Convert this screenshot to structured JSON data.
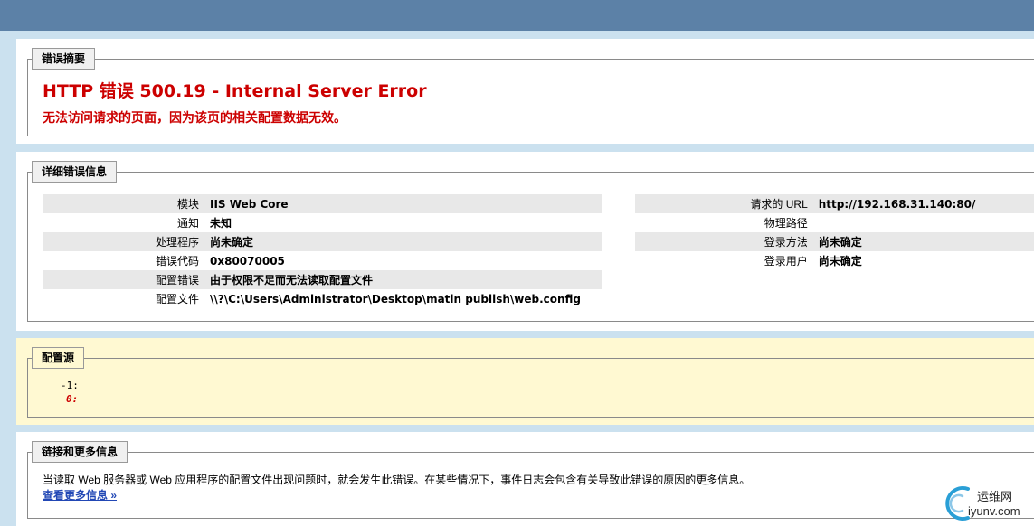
{
  "summary": {
    "legend": "错误摘要",
    "title": "HTTP 错误 500.19 - Internal Server Error",
    "subtitle": "无法访问请求的页面，因为该页的相关配置数据无效。"
  },
  "details": {
    "legend": "详细错误信息",
    "left": [
      {
        "label": "模块",
        "value": "IIS Web Core"
      },
      {
        "label": "通知",
        "value": "未知"
      },
      {
        "label": "处理程序",
        "value": "尚未确定"
      },
      {
        "label": "错误代码",
        "value": "0x80070005"
      },
      {
        "label": "配置错误",
        "value": "由于权限不足而无法读取配置文件"
      },
      {
        "label": "配置文件",
        "value": "\\\\?\\C:\\Users\\Administrator\\Desktop\\matin publish\\web.config"
      }
    ],
    "right": [
      {
        "label": "请求的 URL",
        "value": "http://192.168.31.140:80/"
      },
      {
        "label": "物理路径",
        "value": ""
      },
      {
        "label": "登录方法",
        "value": "尚未确定"
      },
      {
        "label": "登录用户",
        "value": "尚未确定"
      }
    ]
  },
  "config_source": {
    "legend": "配置源",
    "line1": "-1:",
    "line2": "0:"
  },
  "links": {
    "legend": "链接和更多信息",
    "text": "当读取 Web 服务器或 Web 应用程序的配置文件出现问题时，就会发生此错误。在某些情况下，事件日志会包含有关导致此错误的原因的更多信息。",
    "more": "查看更多信息 »"
  },
  "watermark": {
    "cn": "运维网",
    "en": "iyunv.com",
    "accent": "#2a9fd6"
  }
}
